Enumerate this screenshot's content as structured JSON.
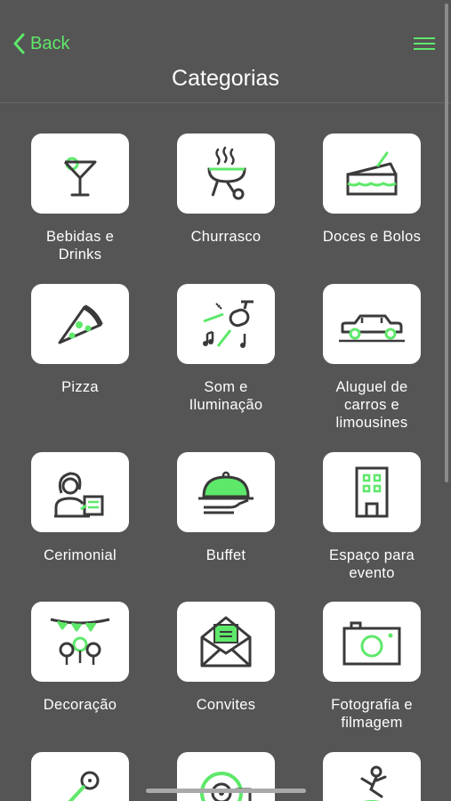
{
  "header": {
    "back_label": "Back",
    "title": "Categorias"
  },
  "colors": {
    "accent": "#5ee86a",
    "background": "#555555",
    "icon_stroke": "#3a3a3a",
    "tile": "#ffffff"
  },
  "categories": [
    {
      "label_1": "Bebidas e",
      "label_2": "Drinks",
      "label_3": "",
      "icon": "cocktail-icon"
    },
    {
      "label_1": "Churrasco",
      "label_2": "",
      "label_3": "",
      "icon": "grill-icon"
    },
    {
      "label_1": "Doces e Bolos",
      "label_2": "",
      "label_3": "",
      "icon": "cake-icon"
    },
    {
      "label_1": "Pizza",
      "label_2": "",
      "label_3": "",
      "icon": "pizza-icon"
    },
    {
      "label_1": "Som e",
      "label_2": "Iluminação",
      "label_3": "",
      "icon": "sound-light-icon"
    },
    {
      "label_1": "Aluguel de",
      "label_2": "carros e",
      "label_3": "limousines",
      "icon": "limousine-icon"
    },
    {
      "label_1": "Cerimonial",
      "label_2": "",
      "label_3": "",
      "icon": "host-icon"
    },
    {
      "label_1": "Buffet",
      "label_2": "",
      "label_3": "",
      "icon": "cloche-icon"
    },
    {
      "label_1": "Espaço para",
      "label_2": "evento",
      "label_3": "",
      "icon": "building-icon"
    },
    {
      "label_1": "Decoração",
      "label_2": "",
      "label_3": "",
      "icon": "decoration-icon"
    },
    {
      "label_1": "Convites",
      "label_2": "",
      "label_3": "",
      "icon": "envelope-icon"
    },
    {
      "label_1": "Fotografia e",
      "label_2": "filmagem",
      "label_3": "",
      "icon": "camera-icon"
    },
    {
      "label_1": "",
      "label_2": "",
      "label_3": "",
      "icon": "microphone-icon"
    },
    {
      "label_1": "",
      "label_2": "",
      "label_3": "",
      "icon": "dj-icon"
    },
    {
      "label_1": "",
      "label_2": "",
      "label_3": "",
      "icon": "dancer-icon"
    }
  ]
}
